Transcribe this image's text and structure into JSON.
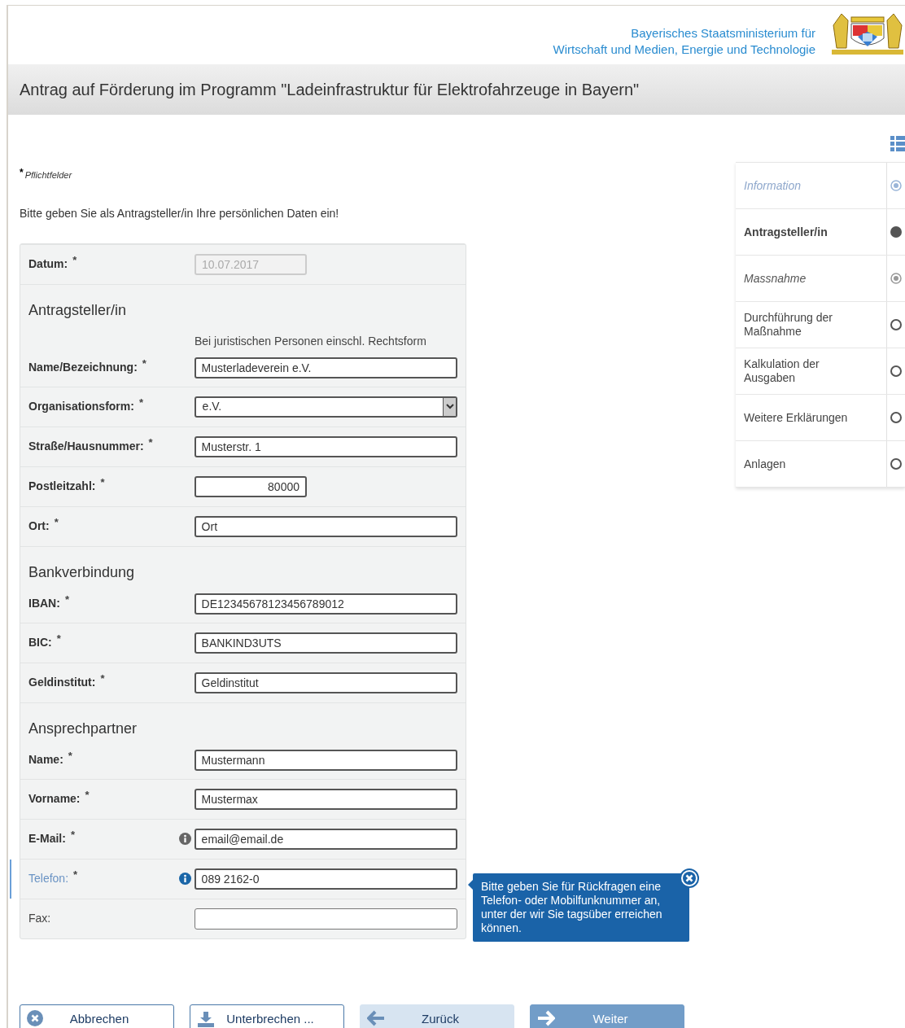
{
  "header": {
    "ministry_lines": [
      "Bayerisches Staatsministerium für",
      "Wirtschaft und Medien, Energie und Technologie"
    ]
  },
  "title": "Antrag auf Förderung im Programm \"Ladeinfrastruktur für Elektrofahrzeuge in Bayern\"",
  "required_note": {
    "mark": "*",
    "text": "Pflichtfelder"
  },
  "intro": "Bitte geben Sie als Antragsteller/in Ihre persönlichen Daten ein!",
  "form_rows": [
    {
      "kind": "short-field",
      "label": "Datum:",
      "required_mark": "*",
      "value": "10.07.2017",
      "disabled": true
    },
    {
      "kind": "heading",
      "text": "Antragsteller/in"
    },
    {
      "kind": "field",
      "label": "Name/Bezeichnung:",
      "required_mark": "*",
      "value": "Musterladeverein e.V.",
      "hint": "Bei juristischen Personen einschl. Rechtsform"
    },
    {
      "kind": "select",
      "label": "Organisationsform:",
      "required_mark": "*",
      "value": "e.V."
    },
    {
      "kind": "field",
      "label": "Straße/Hausnummer:",
      "required_mark": "*",
      "value": "Musterstr. 1"
    },
    {
      "kind": "number-field",
      "label": "Postleitzahl:",
      "required_mark": "*",
      "value": "80000"
    },
    {
      "kind": "field",
      "label": "Ort:",
      "required_mark": "*",
      "value": "Ort"
    },
    {
      "kind": "heading",
      "text": "Bankverbindung"
    },
    {
      "kind": "field",
      "label": "IBAN:",
      "required_mark": "*",
      "value": "DE12345678123456789012"
    },
    {
      "kind": "field",
      "label": "BIC:",
      "required_mark": "*",
      "value": "BANKIND3UTS"
    },
    {
      "kind": "field",
      "label": "Geldinstitut:",
      "required_mark": "*",
      "value": "Geldinstitut"
    },
    {
      "kind": "heading",
      "text": "Ansprechpartner"
    },
    {
      "kind": "field",
      "label": "Name:",
      "required_mark": "*",
      "value": "Mustermann"
    },
    {
      "kind": "field",
      "label": "Vorname:",
      "required_mark": "*",
      "value": "Mustermax"
    },
    {
      "kind": "field",
      "label": "E-Mail:",
      "required_mark": "*",
      "value": "email@email.de",
      "info": true,
      "active": false
    },
    {
      "kind": "field",
      "label": "Telefon:",
      "required_mark": "*",
      "value": "089 2162-0",
      "info": true,
      "active": true
    },
    {
      "kind": "field",
      "label": "Fax:"
    }
  ],
  "tooltip": {
    "text": "Bitte geben Sie für Rückfragen eine Telefon- oder Mobilfunknummer an, unter der wir Sie tagsüber erreichen können."
  },
  "buttons": [
    {
      "label": "Abbrechen",
      "kind": "cancel"
    },
    {
      "label": "Unterbrechen ...",
      "kind": "pause"
    },
    {
      "label": "Zurück",
      "kind": "back"
    },
    {
      "label": "Weiter",
      "kind": "next"
    }
  ],
  "steps": [
    {
      "label": "Information",
      "selected": false,
      "visited": true,
      "disabled": true
    },
    {
      "label": "Antragsteller/in",
      "selected": true,
      "visited": false,
      "disabled": false
    },
    {
      "label": "Massnahme",
      "selected": false,
      "visited": true,
      "disabled": false
    },
    {
      "label": "Durchführung der Maßnahme",
      "selected": false,
      "visited": false,
      "disabled": false
    },
    {
      "label": "Kalkulation der Ausgaben",
      "selected": false,
      "visited": false,
      "disabled": false
    },
    {
      "label": "Weitere Erklärungen",
      "selected": false,
      "visited": false,
      "disabled": false
    },
    {
      "label": "Anlagen",
      "selected": false,
      "visited": false,
      "disabled": false
    }
  ]
}
